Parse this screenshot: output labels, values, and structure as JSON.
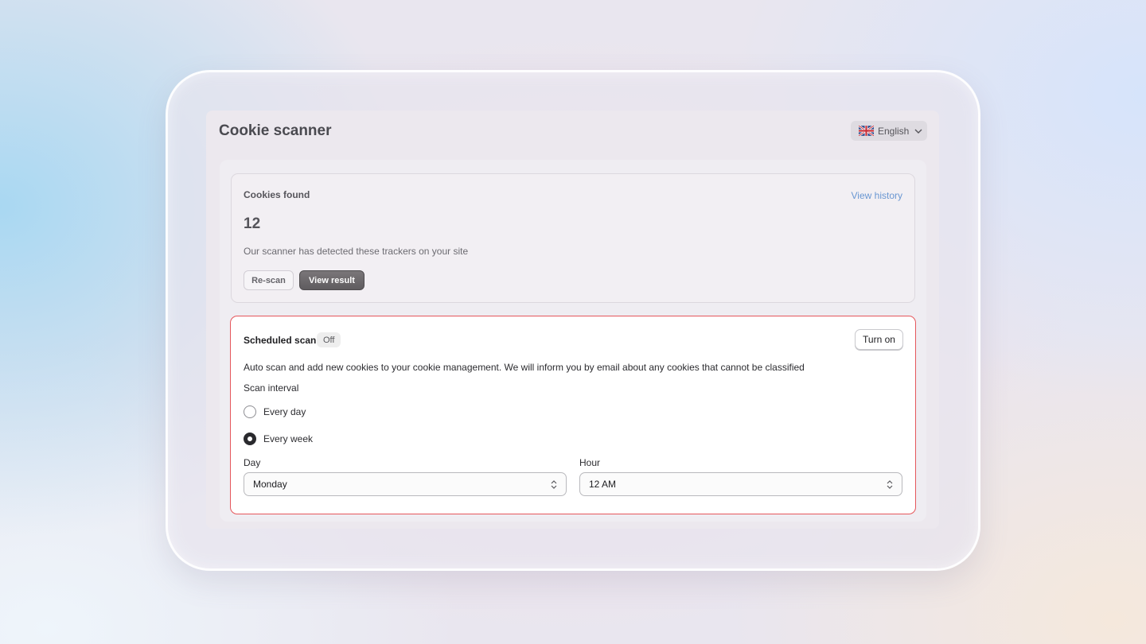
{
  "page": {
    "title": "Cookie scanner"
  },
  "language": {
    "flag_icon": "uk-flag-icon",
    "label": "English",
    "chevron_icon": "chevron-down-icon"
  },
  "cookies_found": {
    "title": "Cookies found",
    "view_history": "View history",
    "count": "12",
    "description": "Our scanner has detected these trackers on your site",
    "rescan_label": "Re-scan",
    "view_result_label": "View result"
  },
  "scheduled_scan": {
    "title": "Scheduled scan",
    "status_badge": "Off",
    "turn_on_label": "Turn on",
    "description": "Auto scan and add new cookies to your cookie management. We will inform you by email about any cookies that cannot be classified",
    "interval_label": "Scan interval",
    "options": [
      {
        "label": "Every day",
        "selected": false
      },
      {
        "label": "Every week",
        "selected": true
      }
    ],
    "day": {
      "label": "Day",
      "value": "Monday"
    },
    "hour": {
      "label": "Hour",
      "value": "12 AM"
    }
  },
  "colors": {
    "accent_link": "#6a97d2",
    "highlight_border": "#e5565b",
    "primary_button": "#5f5c5f"
  }
}
